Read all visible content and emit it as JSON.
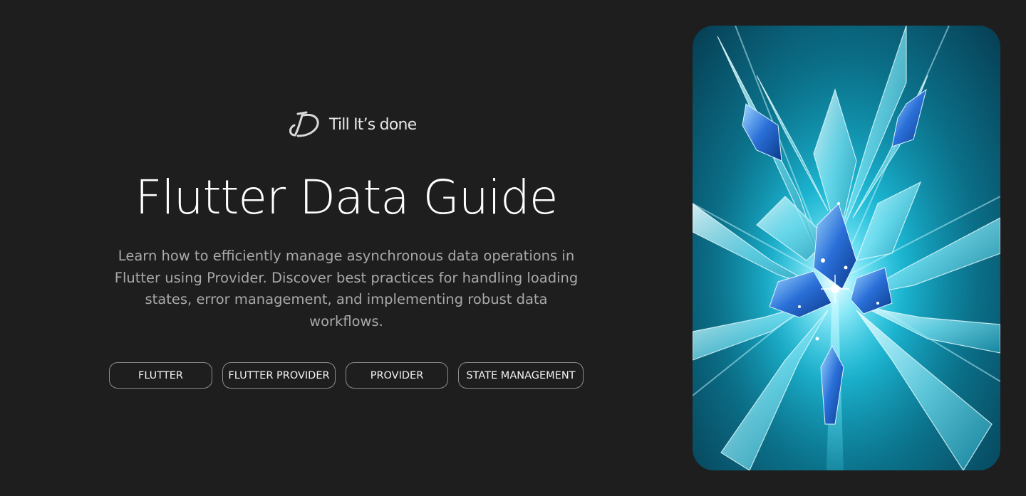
{
  "brand": {
    "name": "Till It’s done",
    "logo_icon": "td-monogram-icon"
  },
  "hero": {
    "title": "Flutter Data Guide",
    "description": "Learn how to efficiently manage asynchronous data operations in Flutter using Provider. Discover best practices for handling loading states, error management, and implementing robust data workflows."
  },
  "tags": [
    {
      "label": "FLUTTER"
    },
    {
      "label": "FLUTTER PROVIDER"
    },
    {
      "label": "PROVIDER"
    },
    {
      "label": "STATE MANAGEMENT"
    }
  ],
  "image": {
    "subject": "ice-crystal-artwork",
    "colors": {
      "light": "#bff6ff",
      "mid": "#19b9d6",
      "dark": "#053a4f",
      "gem": "#2a6fd8"
    }
  }
}
